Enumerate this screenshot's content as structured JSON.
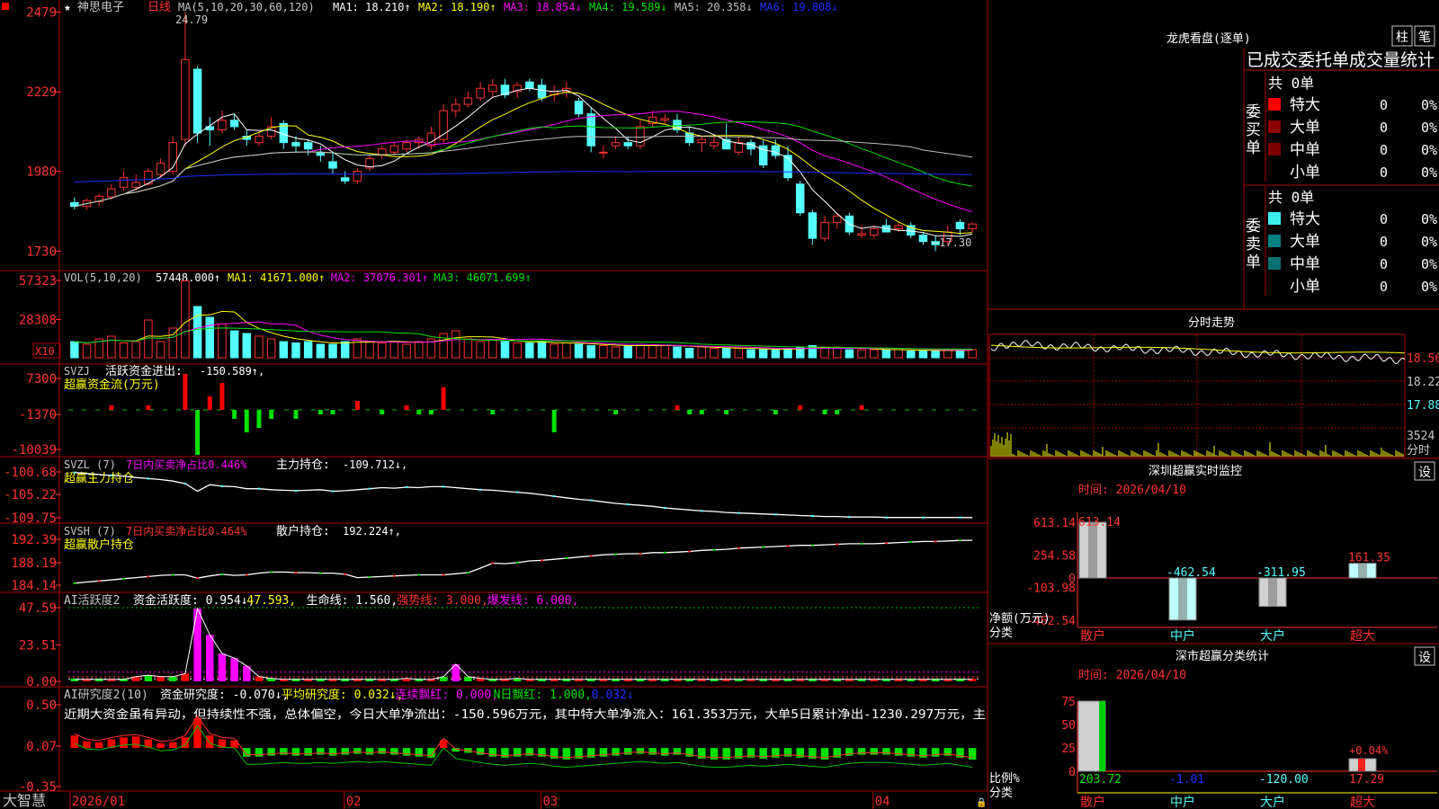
{
  "stock": {
    "name": "神思电子",
    "period": "日线"
  },
  "colors": {
    "up": "#ff3232",
    "down": "#54ffff",
    "grid": "#b00000",
    "ma1": "#ffffff",
    "ma2": "#ffff00",
    "ma3": "#ff00ff",
    "ma4": "#00e000",
    "ma5": "#c0c0c0",
    "ma6": "#1e32ff"
  },
  "main_panel": {
    "ma_label": "MA(5,10,20,30,60,120)",
    "ma_values": [
      {
        "name": "MA1:",
        "value": "18.210↑",
        "color": "#ffffff"
      },
      {
        "name": "MA2:",
        "value": "18.190↑",
        "color": "#ffff00"
      },
      {
        "name": "MA3:",
        "value": "18.854↓",
        "color": "#ff00ff"
      },
      {
        "name": "MA4:",
        "value": "19.589↓",
        "color": "#00e000"
      },
      {
        "name": "MA5:",
        "value": "20.358↓",
        "color": "#c0c0c0"
      },
      {
        "name": "MA6:",
        "value": "19.808↓",
        "color": "#1e32ff"
      }
    ],
    "y_ticks": [
      "2479",
      "2229",
      "1980",
      "1730"
    ],
    "high_note": "24.79",
    "low_note": "←17.30"
  },
  "vol_panel": {
    "label": "VOL(5,10,20)",
    "value": "57448.000↑",
    "ma": [
      {
        "name": "MA1:",
        "value": "41671.000↑",
        "color": "#ffff00"
      },
      {
        "name": "MA2:",
        "value": "37076.301↑",
        "color": "#ff00ff"
      },
      {
        "name": "MA3:",
        "value": "46071.699↑",
        "color": "#00e000"
      }
    ],
    "y_ticks": [
      "57323",
      "28308"
    ],
    "unit": "X10"
  },
  "svzj_panel": {
    "label": "SVZJ",
    "title": "活跃资金进出:",
    "value": "-150.589↑,",
    "sub": "超赢资金流(万元)",
    "y_ticks": [
      "7300",
      "-1370",
      "-10039"
    ]
  },
  "svzl_panel": {
    "label": "SVZL (7)",
    "ratio": "7日内买卖净占比0.446%",
    "hold_label": "主力持仓:",
    "hold_value": "-109.712↓,",
    "sub": "超赢主力持仓",
    "y_ticks": [
      "-100.68",
      "-105.22",
      "-109.75"
    ]
  },
  "svsh_panel": {
    "label": "SVSH (7)",
    "ratio": "7日内买卖净占比0.464%",
    "hold_label": "散户持仓:",
    "hold_value": "192.224↑,",
    "sub": "超赢散户持仓",
    "y_ticks": [
      "192.39",
      "188.19",
      "184.14"
    ]
  },
  "ai_active_panel": {
    "label": "AI活跃度2",
    "items": [
      {
        "text": "资金活跃度: 0.954↓,",
        "color": "#ffffff"
      },
      {
        "text": "47.593,",
        "color": "#ffff00"
      },
      {
        "text": "生命线: 1.560,",
        "color": "#ffffff"
      },
      {
        "text": "强势线: 3.000,",
        "color": "#ff3232"
      },
      {
        "text": "爆发线: 6.000,",
        "color": "#ff00ff"
      }
    ],
    "y_ticks": [
      "47.59",
      "23.51",
      "0.00"
    ]
  },
  "ai_research_panel": {
    "label": "AI研究度2(10)",
    "items": [
      {
        "text": "资金研究度: -0.070↓,",
        "color": "#ffffff"
      },
      {
        "text": "平均研究度: 0.032↓,",
        "color": "#ffff00"
      },
      {
        "text": "连续飘红: 0.000,",
        "color": "#ff00ff"
      },
      {
        "text": "N日飘红: 1.000,",
        "color": "#00e000"
      },
      {
        "text": "0.032↓",
        "color": "#1e32ff"
      }
    ],
    "description": "近期大资金虽有异动，但持续性不强，总体偏空，今日大单净流出：-150.596万元，其中特大单净流入：161.353万元，大单5日累计净出-1230.297万元，主",
    "y_ticks": [
      "0.50",
      "0.07",
      "-0.35"
    ]
  },
  "x_axis": {
    "brand": "大智慧",
    "labels": [
      "2026/01",
      "02",
      "03",
      "04"
    ]
  },
  "dragon_panel": {
    "title": "龙虎看盘(逐单)",
    "buttons": [
      "柱",
      "笔"
    ],
    "header": "已成交委托单成交量统计",
    "buy": {
      "side": "委买单",
      "total": "共 0单",
      "rows": [
        {
          "name": "特大",
          "count": "0",
          "pct": "0%",
          "color": "#ff0000"
        },
        {
          "name": "大单",
          "count": "0",
          "pct": "0%",
          "color": "#8b0000"
        },
        {
          "name": "中单",
          "count": "0",
          "pct": "0%",
          "color": "#7a0000"
        },
        {
          "name": "小单",
          "count": "0",
          "pct": "0%",
          "color": ""
        }
      ]
    },
    "sell": {
      "side": "委卖单",
      "total": "共 0单",
      "rows": [
        {
          "name": "特大",
          "count": "0",
          "pct": "0%",
          "color": "#3cf0f0"
        },
        {
          "name": "大单",
          "count": "0",
          "pct": "0%",
          "color": "#008080"
        },
        {
          "name": "中单",
          "count": "0",
          "pct": "0%",
          "color": "#0c7070"
        },
        {
          "name": "小单",
          "count": "0",
          "pct": "0%",
          "color": ""
        }
      ]
    }
  },
  "intraday_panel": {
    "title": "分时走势",
    "y_ticks": [
      "18.56",
      "18.22",
      "17.88"
    ],
    "vol_tick": "3524",
    "vol_label": "分时"
  },
  "sz_monitor": {
    "title": "深圳超赢实时监控",
    "setting": "设",
    "time": "时间: 2026/04/10",
    "y_ticks": [
      "613.14",
      "254.58",
      "0",
      "-103.98",
      "-462.54"
    ],
    "unit_label": "净额(万元)",
    "class_label": "分类",
    "categories": [
      "散户",
      "中户",
      "大户",
      "超大"
    ],
    "values": [
      613.14,
      -462.54,
      -311.95,
      161.35
    ],
    "value_labels": [
      "613.14",
      "-462.54",
      "-311.95",
      "161.35"
    ]
  },
  "sz_class": {
    "title": "深市超赢分类统计",
    "setting": "设",
    "time": "时间: 2026/04/10",
    "y_ticks": [
      "75",
      "50",
      "25",
      "0"
    ],
    "ratio_label": "比例%",
    "class_label": "分类",
    "categories": [
      "散户",
      "中户",
      "大户",
      "超大"
    ],
    "values": [
      "203.72",
      "-1.01",
      "-120.00",
      "17.29"
    ],
    "top_label": "+0.04%"
  },
  "chart_data": {
    "type": "candlestick",
    "price_unit": "元",
    "candles": [
      {
        "o": 18.82,
        "h": 18.98,
        "l": 18.6,
        "c": 18.7
      },
      {
        "o": 18.7,
        "h": 18.95,
        "l": 18.6,
        "c": 18.88
      },
      {
        "o": 18.85,
        "h": 19.1,
        "l": 18.7,
        "c": 19.02
      },
      {
        "o": 19.0,
        "h": 19.4,
        "l": 18.9,
        "c": 19.25
      },
      {
        "o": 19.3,
        "h": 19.8,
        "l": 19.2,
        "c": 19.6
      },
      {
        "o": 19.3,
        "h": 19.7,
        "l": 19.2,
        "c": 19.45
      },
      {
        "o": 19.4,
        "h": 19.9,
        "l": 19.35,
        "c": 19.8
      },
      {
        "o": 19.7,
        "h": 20.2,
        "l": 19.6,
        "c": 20.05
      },
      {
        "o": 19.8,
        "h": 20.9,
        "l": 19.7,
        "c": 20.7
      },
      {
        "o": 20.8,
        "h": 24.79,
        "l": 20.6,
        "c": 23.3
      },
      {
        "o": 23.0,
        "h": 23.1,
        "l": 20.7,
        "c": 21.0
      },
      {
        "o": 21.2,
        "h": 21.5,
        "l": 20.6,
        "c": 21.1
      },
      {
        "o": 21.1,
        "h": 21.7,
        "l": 21.0,
        "c": 21.4
      },
      {
        "o": 21.4,
        "h": 21.6,
        "l": 21.1,
        "c": 21.2
      },
      {
        "o": 20.9,
        "h": 21.1,
        "l": 20.6,
        "c": 20.8
      },
      {
        "o": 20.7,
        "h": 21.0,
        "l": 20.6,
        "c": 20.9
      },
      {
        "o": 20.9,
        "h": 21.5,
        "l": 20.8,
        "c": 21.2
      },
      {
        "o": 21.3,
        "h": 21.4,
        "l": 20.5,
        "c": 20.7
      },
      {
        "o": 20.7,
        "h": 20.9,
        "l": 20.4,
        "c": 20.6
      },
      {
        "o": 20.7,
        "h": 20.8,
        "l": 20.3,
        "c": 20.5
      },
      {
        "o": 20.4,
        "h": 20.6,
        "l": 20.1,
        "c": 20.3
      },
      {
        "o": 20.1,
        "h": 20.4,
        "l": 19.7,
        "c": 19.9
      },
      {
        "o": 19.6,
        "h": 19.8,
        "l": 19.4,
        "c": 19.5
      },
      {
        "o": 19.5,
        "h": 19.9,
        "l": 19.4,
        "c": 19.8
      },
      {
        "o": 19.9,
        "h": 20.3,
        "l": 19.8,
        "c": 20.2
      },
      {
        "o": 20.3,
        "h": 20.6,
        "l": 20.2,
        "c": 20.5
      },
      {
        "o": 20.4,
        "h": 20.7,
        "l": 20.3,
        "c": 20.6
      },
      {
        "o": 20.5,
        "h": 20.8,
        "l": 20.4,
        "c": 20.7
      },
      {
        "o": 20.7,
        "h": 20.9,
        "l": 20.5,
        "c": 20.8
      },
      {
        "o": 20.6,
        "h": 21.2,
        "l": 20.5,
        "c": 21.0
      },
      {
        "o": 20.8,
        "h": 21.9,
        "l": 20.7,
        "c": 21.7
      },
      {
        "o": 21.7,
        "h": 22.1,
        "l": 21.5,
        "c": 21.9
      },
      {
        "o": 21.9,
        "h": 22.3,
        "l": 21.8,
        "c": 22.1
      },
      {
        "o": 22.1,
        "h": 22.6,
        "l": 22.0,
        "c": 22.4
      },
      {
        "o": 22.3,
        "h": 22.7,
        "l": 22.1,
        "c": 22.5
      },
      {
        "o": 22.5,
        "h": 22.7,
        "l": 22.1,
        "c": 22.2
      },
      {
        "o": 22.3,
        "h": 22.6,
        "l": 22.1,
        "c": 22.5
      },
      {
        "o": 22.6,
        "h": 22.7,
        "l": 22.3,
        "c": 22.4
      },
      {
        "o": 22.5,
        "h": 22.7,
        "l": 22.0,
        "c": 22.1
      },
      {
        "o": 22.2,
        "h": 22.5,
        "l": 22.0,
        "c": 22.3
      },
      {
        "o": 22.3,
        "h": 22.6,
        "l": 22.1,
        "c": 22.4
      },
      {
        "o": 22.0,
        "h": 22.1,
        "l": 21.5,
        "c": 21.6
      },
      {
        "o": 21.6,
        "h": 21.8,
        "l": 20.4,
        "c": 20.6
      },
      {
        "o": 20.4,
        "h": 20.6,
        "l": 20.2,
        "c": 20.4
      },
      {
        "o": 20.6,
        "h": 20.9,
        "l": 20.5,
        "c": 20.7
      },
      {
        "o": 20.7,
        "h": 20.9,
        "l": 20.5,
        "c": 20.6
      },
      {
        "o": 20.6,
        "h": 21.4,
        "l": 20.5,
        "c": 21.2
      },
      {
        "o": 21.3,
        "h": 21.7,
        "l": 21.2,
        "c": 21.5
      },
      {
        "o": 21.4,
        "h": 21.6,
        "l": 21.3,
        "c": 21.45
      },
      {
        "o": 21.4,
        "h": 21.6,
        "l": 21.0,
        "c": 21.1
      },
      {
        "o": 21.0,
        "h": 21.2,
        "l": 20.6,
        "c": 20.7
      },
      {
        "o": 20.7,
        "h": 20.9,
        "l": 20.4,
        "c": 20.8
      },
      {
        "o": 20.6,
        "h": 20.9,
        "l": 20.5,
        "c": 20.7
      },
      {
        "o": 20.8,
        "h": 21.3,
        "l": 20.6,
        "c": 20.5
      },
      {
        "o": 20.4,
        "h": 20.9,
        "l": 20.3,
        "c": 20.7
      },
      {
        "o": 20.7,
        "h": 20.8,
        "l": 20.3,
        "c": 20.5
      },
      {
        "o": 20.6,
        "h": 20.8,
        "l": 19.9,
        "c": 20.0
      },
      {
        "o": 20.6,
        "h": 20.8,
        "l": 20.2,
        "c": 20.3
      },
      {
        "o": 20.3,
        "h": 20.6,
        "l": 19.5,
        "c": 19.6
      },
      {
        "o": 19.4,
        "h": 19.5,
        "l": 18.4,
        "c": 18.5
      },
      {
        "o": 18.5,
        "h": 18.6,
        "l": 17.5,
        "c": 17.7
      },
      {
        "o": 17.7,
        "h": 18.4,
        "l": 17.6,
        "c": 18.2
      },
      {
        "o": 18.2,
        "h": 18.5,
        "l": 18.0,
        "c": 18.4
      },
      {
        "o": 18.4,
        "h": 18.5,
        "l": 17.8,
        "c": 17.9
      },
      {
        "o": 17.8,
        "h": 18.1,
        "l": 17.7,
        "c": 17.85
      },
      {
        "o": 17.8,
        "h": 18.1,
        "l": 17.7,
        "c": 18.0
      },
      {
        "o": 18.1,
        "h": 18.3,
        "l": 17.9,
        "c": 17.9
      },
      {
        "o": 18.0,
        "h": 18.2,
        "l": 17.9,
        "c": 18.1
      },
      {
        "o": 18.1,
        "h": 18.2,
        "l": 17.7,
        "c": 17.8
      },
      {
        "o": 17.8,
        "h": 17.9,
        "l": 17.5,
        "c": 17.6
      },
      {
        "o": 17.6,
        "h": 17.8,
        "l": 17.3,
        "c": 17.5
      },
      {
        "o": 17.6,
        "h": 18.1,
        "l": 17.5,
        "c": 17.9
      },
      {
        "o": 18.2,
        "h": 18.3,
        "l": 17.8,
        "c": 18.0
      },
      {
        "o": 18.0,
        "h": 18.2,
        "l": 17.9,
        "c": 18.15
      }
    ],
    "volume": [
      12,
      10,
      14,
      16,
      11,
      12,
      28,
      12,
      22,
      57,
      38,
      30,
      25,
      20,
      18,
      16,
      14,
      12,
      11,
      12,
      10,
      10,
      12,
      14,
      12,
      11,
      12,
      10,
      12,
      14,
      18,
      20,
      14,
      12,
      13,
      12,
      11,
      11,
      12,
      10,
      11,
      10,
      9,
      9,
      8,
      9,
      10,
      9,
      9,
      8,
      7,
      8,
      7,
      7,
      7,
      6,
      6,
      6,
      7,
      8,
      9,
      8,
      7,
      6,
      6,
      6,
      6,
      6,
      5,
      5,
      5,
      6,
      6,
      6
    ],
    "svzj": [
      0,
      0,
      0,
      1,
      0,
      0,
      1,
      0,
      0,
      8,
      -10,
      3,
      6,
      -2,
      -5,
      -4,
      -2,
      0,
      -2,
      0,
      -1,
      -1,
      0,
      2,
      0,
      -1,
      0,
      1,
      -1,
      -1,
      5,
      0,
      0,
      0,
      -1,
      0,
      0,
      0,
      0,
      -5,
      0,
      0,
      0,
      0,
      -1,
      0,
      0,
      0,
      0,
      1,
      -1,
      -1,
      0,
      -1,
      0,
      0,
      0,
      -1,
      0,
      1,
      0,
      -1,
      -1,
      0,
      1,
      0,
      0,
      0,
      0,
      0,
      0,
      0,
      0,
      0
    ],
    "svzl": [
      -100.8,
      -101.0,
      -101.2,
      -101.4,
      -101.5,
      -101.8,
      -102.0,
      -102.2,
      -102.5,
      -103.0,
      -104.5,
      -103.2,
      -103.5,
      -103.6,
      -104.0,
      -104.0,
      -104.2,
      -104.3,
      -104.4,
      -104.3,
      -104.2,
      -104.5,
      -104.4,
      -104.2,
      -104.0,
      -103.8,
      -103.9,
      -103.7,
      -103.8,
      -103.6,
      -103.6,
      -103.8,
      -104.0,
      -104.2,
      -104.3,
      -104.5,
      -104.7,
      -104.9,
      -105.2,
      -105.5,
      -105.8,
      -106.1,
      -106.3,
      -106.6,
      -106.9,
      -107.1,
      -107.3,
      -107.5,
      -107.8,
      -108.0,
      -108.2,
      -108.4,
      -108.5,
      -108.7,
      -108.8,
      -108.9,
      -109.0,
      -109.1,
      -109.2,
      -109.3,
      -109.4,
      -109.5,
      -109.5,
      -109.6,
      -109.6,
      -109.6,
      -109.7,
      -109.7,
      -109.7,
      -109.7,
      -109.7,
      -109.7,
      -109.7,
      -109.71
    ],
    "svsh": [
      184.5,
      184.7,
      184.9,
      185.1,
      185.3,
      185.5,
      185.7,
      185.9,
      186.0,
      186.0,
      185.4,
      185.8,
      186.1,
      185.9,
      186.0,
      186.3,
      186.5,
      186.5,
      186.4,
      186.4,
      186.3,
      186.3,
      186.1,
      185.5,
      185.6,
      185.7,
      185.8,
      185.9,
      186.0,
      186.0,
      186.0,
      186.2,
      186.4,
      187.2,
      188.1,
      188.0,
      188.2,
      188.5,
      188.6,
      188.8,
      189.0,
      189.2,
      189.4,
      189.6,
      189.7,
      189.8,
      189.8,
      190.0,
      190.0,
      190.1,
      190.2,
      190.4,
      190.5,
      190.6,
      190.8,
      190.9,
      191.0,
      191.1,
      191.2,
      191.3,
      191.3,
      191.4,
      191.5,
      191.6,
      191.6,
      191.6,
      191.7,
      191.8,
      191.9,
      192.0,
      192.0,
      192.1,
      192.2,
      192.22
    ],
    "ai_active": [
      1,
      1,
      1,
      1,
      1.2,
      3,
      4,
      3,
      3,
      5,
      47,
      30,
      18,
      15,
      10,
      3,
      2,
      1,
      1,
      1,
      1,
      1,
      1,
      1,
      1,
      1,
      1,
      2,
      1,
      1,
      3,
      11,
      3,
      2,
      1,
      1,
      2,
      1,
      1,
      1,
      1,
      1,
      1,
      1,
      1,
      1,
      1,
      1,
      1,
      1,
      1,
      1,
      1,
      1,
      1,
      1,
      1,
      1,
      1,
      1,
      1,
      1,
      1,
      1,
      1,
      1,
      1,
      1,
      1,
      1,
      1,
      1,
      1,
      0.954
    ],
    "ai_research": [
      0.18,
      0.12,
      0.11,
      0.14,
      0.16,
      0.17,
      0.14,
      0.1,
      0.11,
      0.16,
      0.36,
      0.18,
      0.14,
      0.13,
      -0.04,
      -0.04,
      -0.03,
      -0.02,
      -0.03,
      -0.03,
      -0.02,
      -0.03,
      -0.02,
      -0.01,
      -0.02,
      -0.01,
      -0.02,
      -0.03,
      -0.04,
      -0.05,
      0.13,
      0.02,
      0.0,
      -0.02,
      -0.04,
      -0.05,
      -0.04,
      -0.03,
      -0.04,
      -0.06,
      -0.07,
      -0.06,
      -0.05,
      -0.04,
      -0.03,
      -0.02,
      -0.01,
      -0.02,
      -0.03,
      -0.02,
      -0.04,
      -0.06,
      -0.07,
      -0.07,
      -0.06,
      -0.05,
      -0.06,
      -0.05,
      -0.04,
      -0.05,
      -0.06,
      -0.07,
      -0.05,
      -0.03,
      -0.02,
      -0.02,
      -0.02,
      -0.03,
      -0.04,
      -0.05,
      -0.04,
      -0.03,
      -0.05,
      -0.07
    ]
  }
}
